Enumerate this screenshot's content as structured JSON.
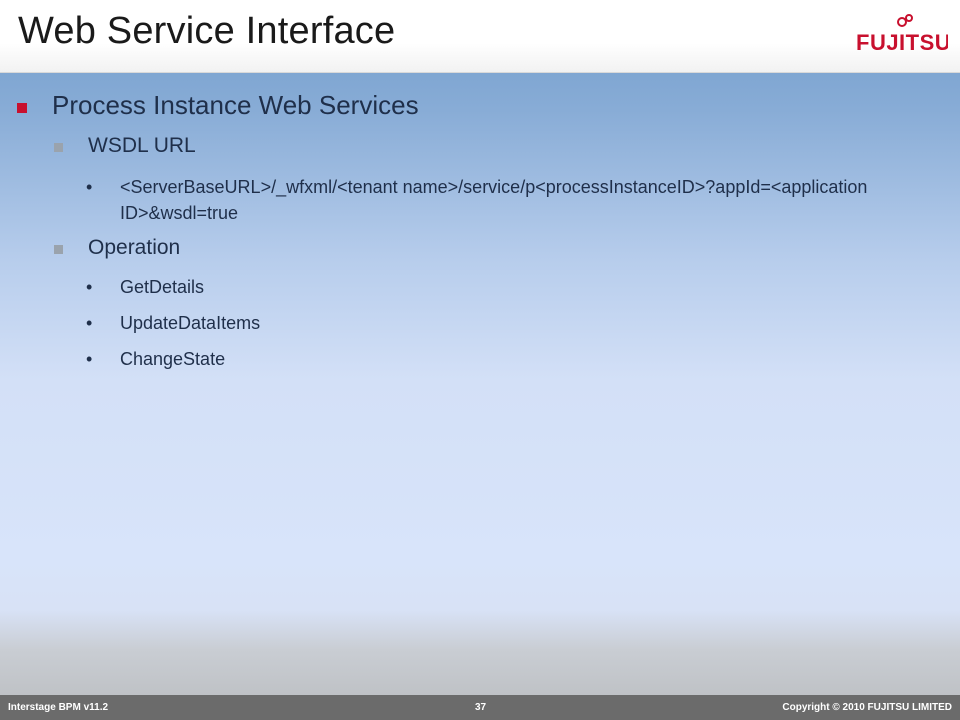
{
  "title": "Web Service Interface",
  "logo_text": "FUJITSU",
  "content": {
    "heading": "Process Instance Web Services",
    "sections": [
      {
        "label": "WSDL URL",
        "items": [
          "<ServerBaseURL>/_wfxml/<tenant name>/service/p<processInstanceID>?appId=<application ID>&wsdl=true"
        ]
      },
      {
        "label": "Operation",
        "items": [
          "GetDetails",
          "UpdateDataItems",
          "ChangeState"
        ]
      }
    ]
  },
  "footer": {
    "left": "Interstage BPM v11.2",
    "page": "37",
    "right": "Copyright © 2010 FUJITSU LIMITED"
  },
  "colors": {
    "accent_red": "#c8102e",
    "text": "#1f2f4a",
    "footer_bg": "#6b6b6b"
  }
}
